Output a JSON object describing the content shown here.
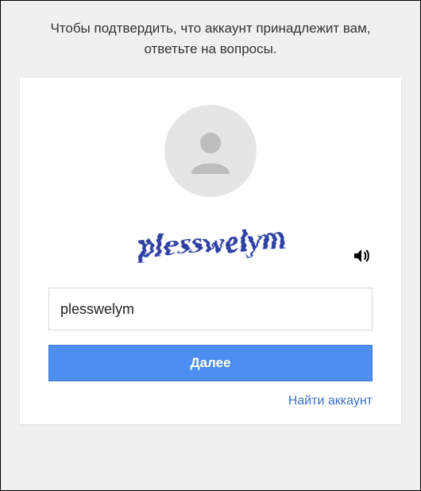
{
  "header": {
    "line1": "Чтобы подтвердить, что аккаунт принадлежит вам,",
    "line2": "ответьте на вопросы."
  },
  "captcha": {
    "text": "plesswelym",
    "audio_icon": "speaker-icon"
  },
  "form": {
    "input_value": "plesswelym",
    "input_placeholder": ""
  },
  "buttons": {
    "next_label": "Далее"
  },
  "links": {
    "find_account": "Найти аккаунт"
  },
  "colors": {
    "primary": "#4d8ff0",
    "link": "#3a70c9",
    "captcha_ink": "#2d3fa3"
  }
}
